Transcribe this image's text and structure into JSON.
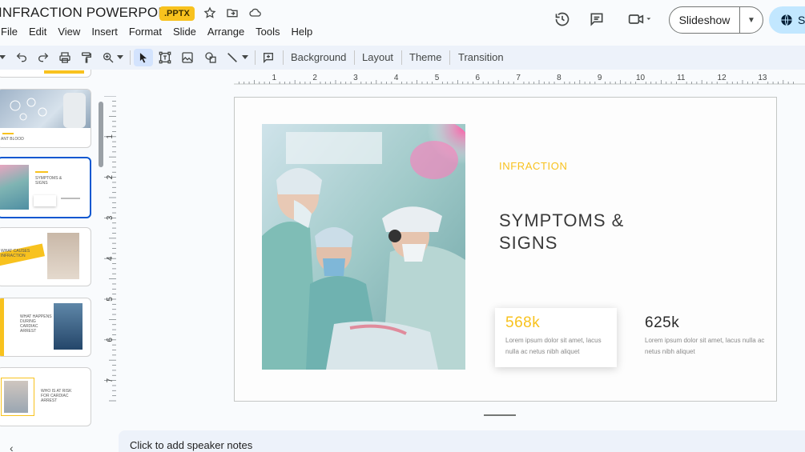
{
  "title_bar": {
    "doc_title": "INFRACTION POWERPOINT",
    "ext_badge": ".PPTX",
    "icons": [
      "star-icon",
      "move-to-folder-icon",
      "cloud-status-icon"
    ]
  },
  "menubar": {
    "items": [
      "File",
      "Edit",
      "View",
      "Insert",
      "Format",
      "Slide",
      "Arrange",
      "Tools",
      "Help"
    ]
  },
  "header_right": {
    "history_icon": "history-icon",
    "comments_icon": "comment-icon",
    "meet_icon": "video-camera-icon",
    "slideshow_label": "Slideshow",
    "share_label": "S"
  },
  "toolbar": {
    "background_label": "Background",
    "layout_label": "Layout",
    "theme_label": "Theme",
    "transition_label": "Transition"
  },
  "ruler": {
    "h_labels": [
      "1",
      "2",
      "3",
      "4",
      "5",
      "6",
      "7",
      "8",
      "9",
      "10",
      "11",
      "12",
      "13"
    ],
    "v_labels": [
      "1",
      "2",
      "3",
      "4",
      "5",
      "6",
      "7"
    ]
  },
  "filmstrip": {
    "thumb_texts": {
      "t1_label": "ANT BLOOD",
      "t2_title": "SYMPTOMS & SIGNS",
      "t3_title": "WHAT CAUSES INFRACTION",
      "t4_title": "WHAT HAPPENS DURING CARDIAC ARREST",
      "t5_title": "WHO IS AT RISK FOR CARDIAC ARREST"
    }
  },
  "slide": {
    "kicker": "INFRACTION",
    "title": "SYMPTOMS & SIGNS",
    "stats": [
      {
        "value": "568k",
        "desc": "Lorem ipsum dolor sit amet, lacus nulla ac netus nibh aliquet"
      },
      {
        "value": "625k",
        "desc": "Lorem ipsum dolor sit amet, lacus nulla ac netus nibh aliquet"
      }
    ],
    "accent_color": "#f8c21e"
  },
  "notes": {
    "placeholder": "Click to add speaker notes"
  }
}
